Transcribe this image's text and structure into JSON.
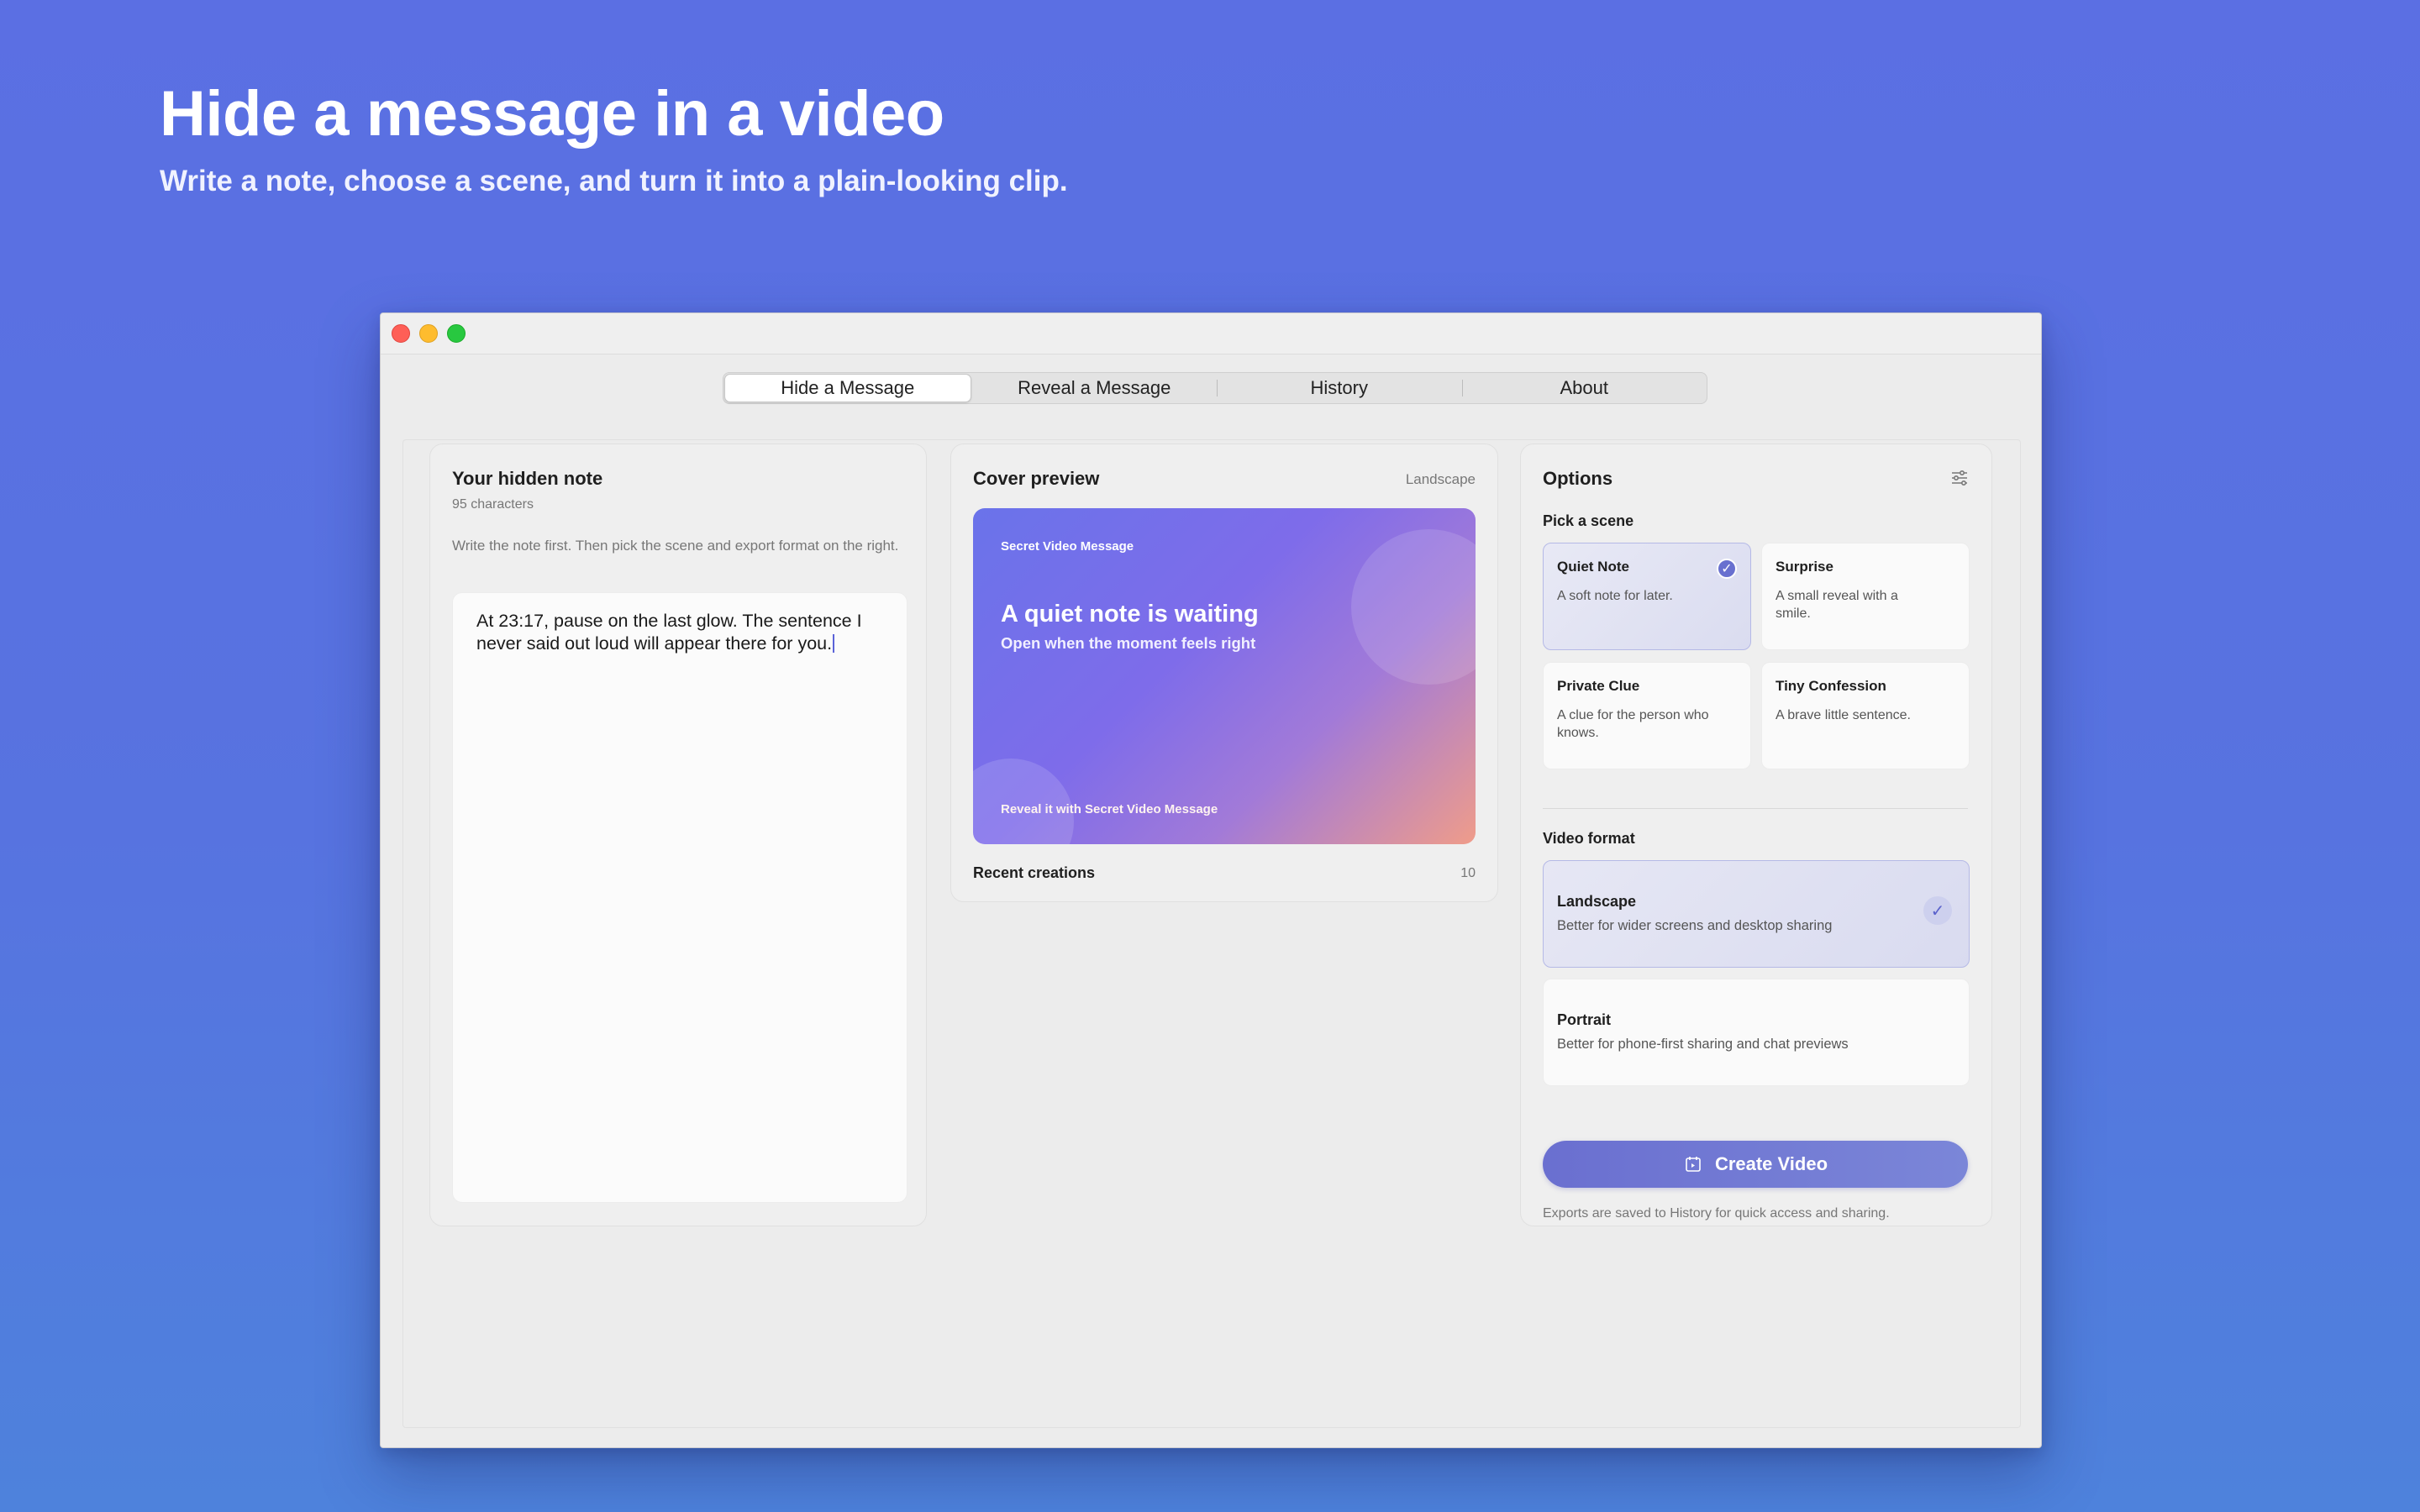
{
  "hero": {
    "title": "Hide a message in a video",
    "subtitle": "Write a note, choose a scene, and turn it into a plain-looking clip."
  },
  "tabs": [
    {
      "label": "Hide a Message",
      "active": true
    },
    {
      "label": "Reveal a Message",
      "active": false
    },
    {
      "label": "History",
      "active": false
    },
    {
      "label": "About",
      "active": false
    }
  ],
  "note": {
    "title": "Your hidden note",
    "char_count": "95 characters",
    "hint": "Write the note first. Then pick the scene and export format on the right.",
    "text": "At 23:17, pause on the last glow. The sentence I never said out loud will appear there for you."
  },
  "preview": {
    "title": "Cover preview",
    "orientation": "Landscape",
    "cover": {
      "brand": "Secret Video Message",
      "headline": "A quiet note is waiting",
      "subheadline": "Open when the moment feels right",
      "footer": "Reveal it with Secret Video Message"
    },
    "recent_label": "Recent creations",
    "recent_count": "10"
  },
  "options": {
    "title": "Options",
    "scene_heading": "Pick a scene",
    "scenes": [
      {
        "title": "Quiet Note",
        "desc": "A soft note for later.",
        "selected": true
      },
      {
        "title": "Surprise",
        "desc": "A small reveal with a smile.",
        "selected": false
      },
      {
        "title": "Private Clue",
        "desc": "A clue for the person who knows.",
        "selected": false
      },
      {
        "title": "Tiny Confession",
        "desc": "A brave little sentence.",
        "selected": false
      }
    ],
    "format_heading": "Video format",
    "formats": [
      {
        "title": "Landscape",
        "desc": "Better for wider screens and desktop sharing",
        "selected": true
      },
      {
        "title": "Portrait",
        "desc": "Better for phone-first sharing and chat previews",
        "selected": false
      }
    ],
    "create_label": "Create Video",
    "footnote": "Exports are saved to History for quick access and sharing."
  },
  "colors": {
    "accent": "#6870cf",
    "background_top": "#5b6fe3",
    "background_bottom": "#4e82dc"
  }
}
